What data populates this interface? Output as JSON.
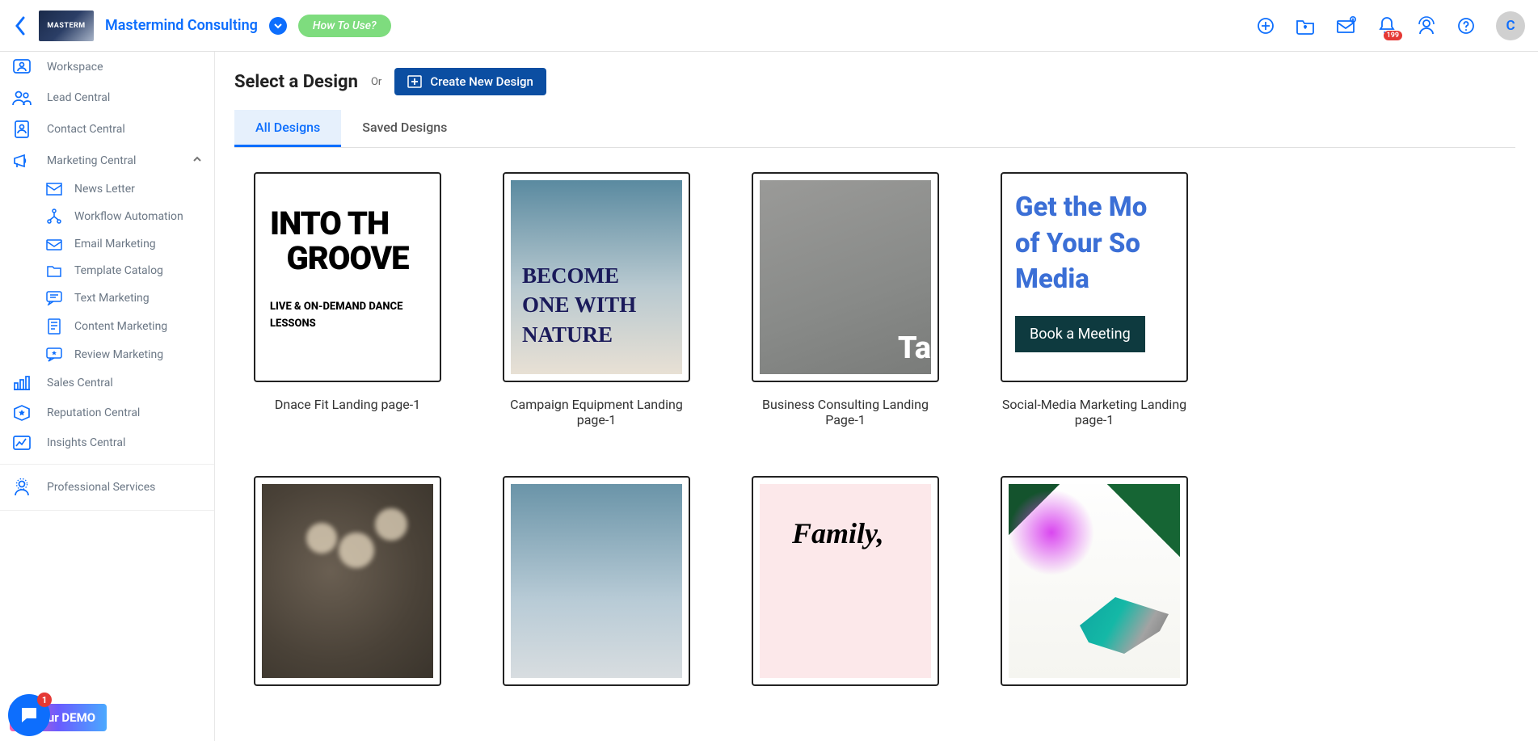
{
  "header": {
    "brand_logo_text": "MASTERM",
    "brand_name": "Mastermind Consulting",
    "how_to_use": "How To Use?",
    "notification_count": "199",
    "avatar_initial": "C"
  },
  "sidebar": {
    "items": [
      {
        "label": "Workspace"
      },
      {
        "label": "Lead Central"
      },
      {
        "label": "Contact Central"
      },
      {
        "label": "Marketing Central"
      },
      {
        "label": "Sales Central"
      },
      {
        "label": "Reputation Central"
      },
      {
        "label": "Insights Central"
      }
    ],
    "marketing_sub": [
      {
        "label": "News Letter"
      },
      {
        "label": "Workflow Automation"
      },
      {
        "label": "Email Marketing"
      },
      {
        "label": "Template Catalog"
      },
      {
        "label": "Text Marketing"
      },
      {
        "label": "Content Marketing"
      },
      {
        "label": "Review Marketing"
      }
    ],
    "pro_services": "Professional Services",
    "demo_label": "et your DEMO",
    "chat_badge": "1"
  },
  "main": {
    "title": "Select a Design",
    "or": "Or",
    "create_btn": "Create New Design",
    "tabs": [
      {
        "label": "All Designs"
      },
      {
        "label": "Saved Designs"
      }
    ],
    "designs": [
      {
        "label": "Dnace Fit Landing page-1"
      },
      {
        "label": "Campaign Equipment Landing page-1"
      },
      {
        "label": "Business Consulting Landing Page-1"
      },
      {
        "label": "Social-Media Marketing Landing page-1"
      }
    ],
    "card1": {
      "h1": "INTO TH",
      "h2": "GROOVE",
      "sub1": "LIVE & ON-DEMAND DANCE",
      "sub2": "LESSONS"
    },
    "card2": {
      "t": "BECOME ONE WITH NATURE"
    },
    "card3": {
      "t": "Ta"
    },
    "card4": {
      "l1": "Get the Mo",
      "l2": "of Your So",
      "l3": "Media",
      "btn": "Book a Meeting"
    },
    "card7": {
      "t": "Family,"
    }
  }
}
